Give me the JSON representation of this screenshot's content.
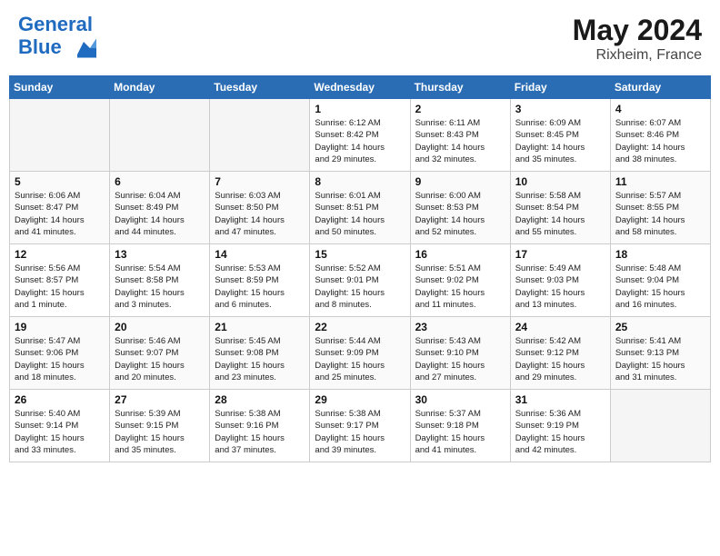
{
  "header": {
    "logo_line1": "General",
    "logo_line2": "Blue",
    "month_year": "May 2024",
    "location": "Rixheim, France"
  },
  "weekdays": [
    "Sunday",
    "Monday",
    "Tuesday",
    "Wednesday",
    "Thursday",
    "Friday",
    "Saturday"
  ],
  "weeks": [
    [
      {
        "day": "",
        "info": ""
      },
      {
        "day": "",
        "info": ""
      },
      {
        "day": "",
        "info": ""
      },
      {
        "day": "1",
        "info": "Sunrise: 6:12 AM\nSunset: 8:42 PM\nDaylight: 14 hours\nand 29 minutes."
      },
      {
        "day": "2",
        "info": "Sunrise: 6:11 AM\nSunset: 8:43 PM\nDaylight: 14 hours\nand 32 minutes."
      },
      {
        "day": "3",
        "info": "Sunrise: 6:09 AM\nSunset: 8:45 PM\nDaylight: 14 hours\nand 35 minutes."
      },
      {
        "day": "4",
        "info": "Sunrise: 6:07 AM\nSunset: 8:46 PM\nDaylight: 14 hours\nand 38 minutes."
      }
    ],
    [
      {
        "day": "5",
        "info": "Sunrise: 6:06 AM\nSunset: 8:47 PM\nDaylight: 14 hours\nand 41 minutes."
      },
      {
        "day": "6",
        "info": "Sunrise: 6:04 AM\nSunset: 8:49 PM\nDaylight: 14 hours\nand 44 minutes."
      },
      {
        "day": "7",
        "info": "Sunrise: 6:03 AM\nSunset: 8:50 PM\nDaylight: 14 hours\nand 47 minutes."
      },
      {
        "day": "8",
        "info": "Sunrise: 6:01 AM\nSunset: 8:51 PM\nDaylight: 14 hours\nand 50 minutes."
      },
      {
        "day": "9",
        "info": "Sunrise: 6:00 AM\nSunset: 8:53 PM\nDaylight: 14 hours\nand 52 minutes."
      },
      {
        "day": "10",
        "info": "Sunrise: 5:58 AM\nSunset: 8:54 PM\nDaylight: 14 hours\nand 55 minutes."
      },
      {
        "day": "11",
        "info": "Sunrise: 5:57 AM\nSunset: 8:55 PM\nDaylight: 14 hours\nand 58 minutes."
      }
    ],
    [
      {
        "day": "12",
        "info": "Sunrise: 5:56 AM\nSunset: 8:57 PM\nDaylight: 15 hours\nand 1 minute."
      },
      {
        "day": "13",
        "info": "Sunrise: 5:54 AM\nSunset: 8:58 PM\nDaylight: 15 hours\nand 3 minutes."
      },
      {
        "day": "14",
        "info": "Sunrise: 5:53 AM\nSunset: 8:59 PM\nDaylight: 15 hours\nand 6 minutes."
      },
      {
        "day": "15",
        "info": "Sunrise: 5:52 AM\nSunset: 9:01 PM\nDaylight: 15 hours\nand 8 minutes."
      },
      {
        "day": "16",
        "info": "Sunrise: 5:51 AM\nSunset: 9:02 PM\nDaylight: 15 hours\nand 11 minutes."
      },
      {
        "day": "17",
        "info": "Sunrise: 5:49 AM\nSunset: 9:03 PM\nDaylight: 15 hours\nand 13 minutes."
      },
      {
        "day": "18",
        "info": "Sunrise: 5:48 AM\nSunset: 9:04 PM\nDaylight: 15 hours\nand 16 minutes."
      }
    ],
    [
      {
        "day": "19",
        "info": "Sunrise: 5:47 AM\nSunset: 9:06 PM\nDaylight: 15 hours\nand 18 minutes."
      },
      {
        "day": "20",
        "info": "Sunrise: 5:46 AM\nSunset: 9:07 PM\nDaylight: 15 hours\nand 20 minutes."
      },
      {
        "day": "21",
        "info": "Sunrise: 5:45 AM\nSunset: 9:08 PM\nDaylight: 15 hours\nand 23 minutes."
      },
      {
        "day": "22",
        "info": "Sunrise: 5:44 AM\nSunset: 9:09 PM\nDaylight: 15 hours\nand 25 minutes."
      },
      {
        "day": "23",
        "info": "Sunrise: 5:43 AM\nSunset: 9:10 PM\nDaylight: 15 hours\nand 27 minutes."
      },
      {
        "day": "24",
        "info": "Sunrise: 5:42 AM\nSunset: 9:12 PM\nDaylight: 15 hours\nand 29 minutes."
      },
      {
        "day": "25",
        "info": "Sunrise: 5:41 AM\nSunset: 9:13 PM\nDaylight: 15 hours\nand 31 minutes."
      }
    ],
    [
      {
        "day": "26",
        "info": "Sunrise: 5:40 AM\nSunset: 9:14 PM\nDaylight: 15 hours\nand 33 minutes."
      },
      {
        "day": "27",
        "info": "Sunrise: 5:39 AM\nSunset: 9:15 PM\nDaylight: 15 hours\nand 35 minutes."
      },
      {
        "day": "28",
        "info": "Sunrise: 5:38 AM\nSunset: 9:16 PM\nDaylight: 15 hours\nand 37 minutes."
      },
      {
        "day": "29",
        "info": "Sunrise: 5:38 AM\nSunset: 9:17 PM\nDaylight: 15 hours\nand 39 minutes."
      },
      {
        "day": "30",
        "info": "Sunrise: 5:37 AM\nSunset: 9:18 PM\nDaylight: 15 hours\nand 41 minutes."
      },
      {
        "day": "31",
        "info": "Sunrise: 5:36 AM\nSunset: 9:19 PM\nDaylight: 15 hours\nand 42 minutes."
      },
      {
        "day": "",
        "info": ""
      }
    ]
  ]
}
